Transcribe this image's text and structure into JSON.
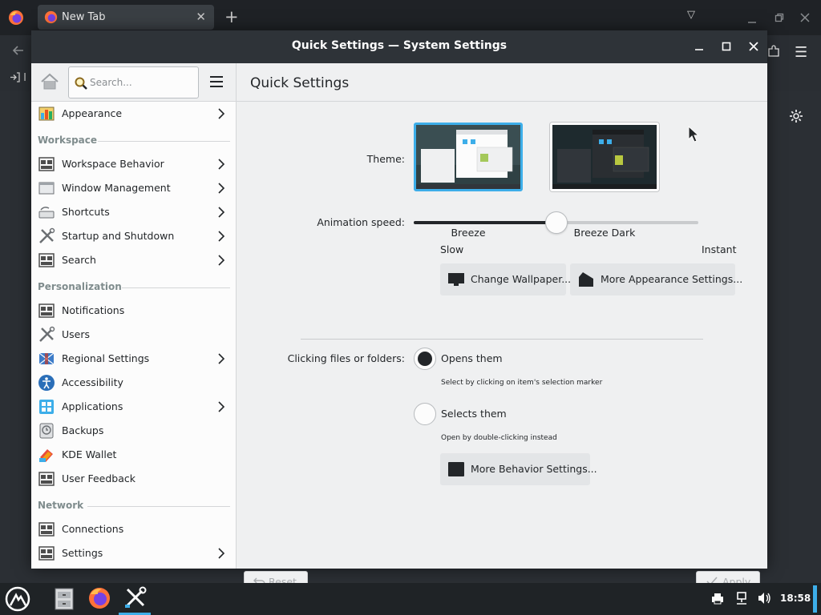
{
  "browser": {
    "tab_title": "New Tab",
    "tab_close": "✕",
    "new_tab": "+",
    "list_tabs": "▽",
    "import_label": "I",
    "menu_icon": "☰"
  },
  "window": {
    "title": "Quick Settings  — System Settings"
  },
  "sidebar": {
    "search_placeholder": "Search...",
    "items": [
      {
        "label": "Appearance",
        "icon": "appearance-icon",
        "chevron": true
      },
      {
        "label": "Workspace Behavior",
        "icon": "workspace-behavior-icon",
        "chevron": true
      },
      {
        "label": "Window Management",
        "icon": "window-management-icon",
        "chevron": true
      },
      {
        "label": "Shortcuts",
        "icon": "shortcuts-icon",
        "chevron": true
      },
      {
        "label": "Startup and Shutdown",
        "icon": "startup-shutdown-icon",
        "chevron": true
      },
      {
        "label": "Search",
        "icon": "search-settings-icon",
        "chevron": true
      },
      {
        "label": "Notifications",
        "icon": "notifications-icon",
        "chevron": false
      },
      {
        "label": "Users",
        "icon": "users-icon",
        "chevron": false
      },
      {
        "label": "Regional Settings",
        "icon": "regional-settings-icon",
        "chevron": true
      },
      {
        "label": "Accessibility",
        "icon": "accessibility-icon",
        "chevron": false
      },
      {
        "label": "Applications",
        "icon": "applications-icon",
        "chevron": true
      },
      {
        "label": "Backups",
        "icon": "backups-icon",
        "chevron": false
      },
      {
        "label": "KDE Wallet",
        "icon": "kde-wallet-icon",
        "chevron": false
      },
      {
        "label": "User Feedback",
        "icon": "user-feedback-icon",
        "chevron": false
      },
      {
        "label": "Connections",
        "icon": "connections-icon",
        "chevron": false
      },
      {
        "label": "Settings",
        "icon": "network-settings-icon",
        "chevron": true
      }
    ],
    "headers": {
      "workspace": "Workspace",
      "personalization": "Personalization",
      "network": "Network"
    }
  },
  "main": {
    "page_title": "Quick Settings",
    "theme_label": "Theme:",
    "themes": [
      {
        "name": "Breeze",
        "selected": true
      },
      {
        "name": "Breeze Dark",
        "selected": false
      }
    ],
    "animation_label": "Animation speed:",
    "animation_slow": "Slow",
    "animation_instant": "Instant",
    "animation_value_fraction": 0.5,
    "change_wallpaper": "Change Wallpaper...",
    "more_appearance": "More Appearance Settings...",
    "clicking_label": "Clicking files or folders:",
    "opens_them": "Opens them",
    "opens_hint": "Select by clicking on item's selection marker",
    "selects_them": "Selects them",
    "selects_hint": "Open by double-clicking instead",
    "selected_click_option": "Opens them",
    "more_behavior": "More Behavior Settings...",
    "reset": "Reset",
    "apply": "Apply"
  },
  "taskbar": {
    "clock": "18:58"
  },
  "colors": {
    "accent": "#3daee9",
    "titlebar": "#2e3338",
    "window_bg": "#eff0f1",
    "taskbar": "#1f2326"
  }
}
